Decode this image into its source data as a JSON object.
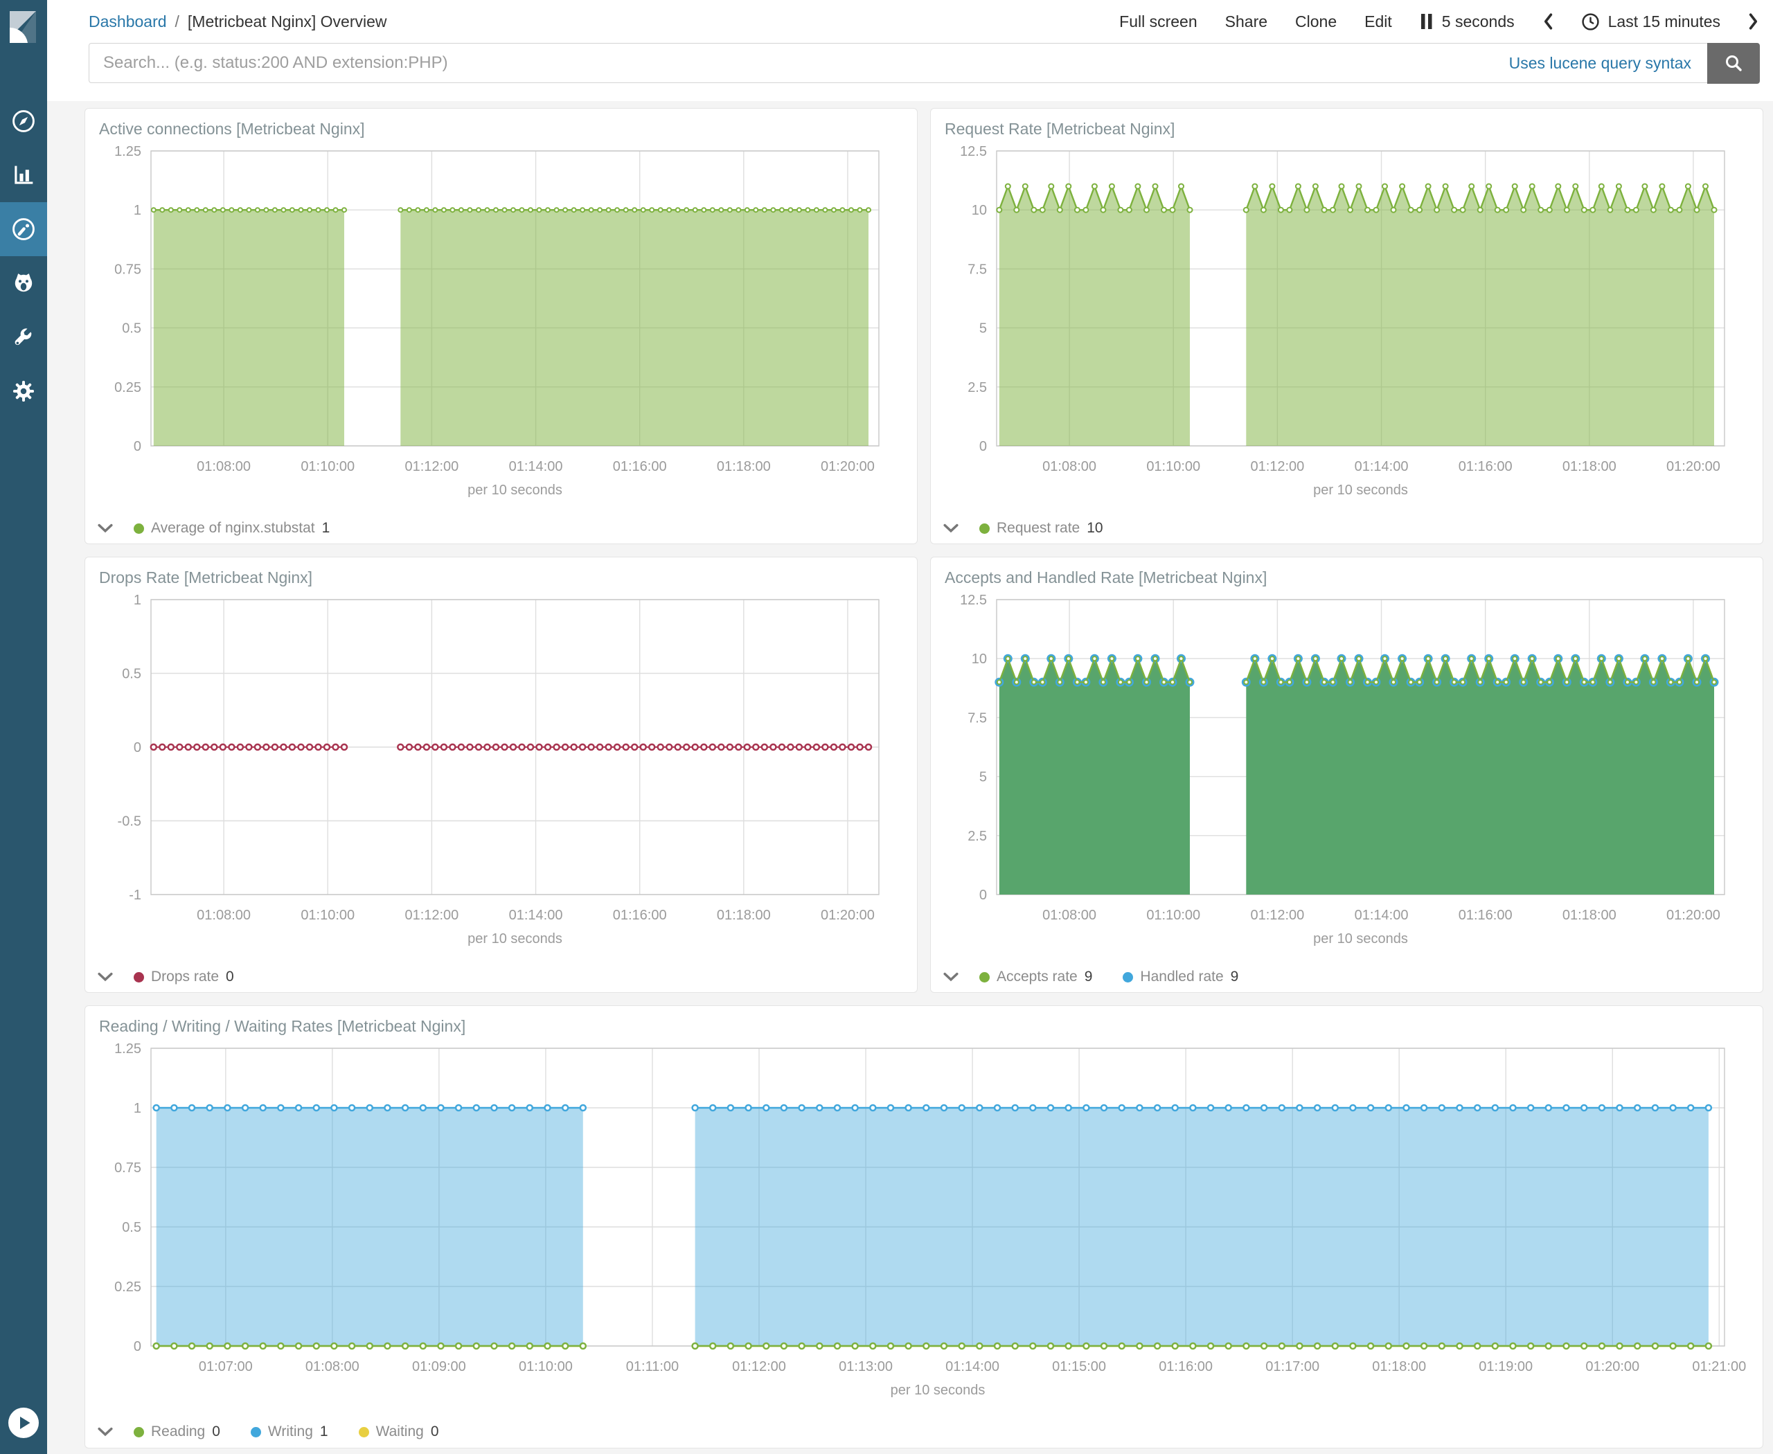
{
  "colors": {
    "sidebar_bg": "#2a566d",
    "sidebar_active_bg": "#3a7fa5",
    "link": "#2977a8",
    "page_bg": "#f4f4f4",
    "panel_title": "#849296",
    "tick": "#9b9b9b",
    "grid": "#dedede",
    "plot_border": "#c8c8c8",
    "green": "#7db13e",
    "green_fill": "rgba(125,177,62,0.5)",
    "blue": "#41a7dc",
    "blue_fill": "rgba(65,167,220,0.42)",
    "crimson": "#a8334f",
    "yellow": "#e8cf41",
    "accepts_fill": "#58a56c",
    "search_button_bg": "#6a6a6a"
  },
  "sidebar": {
    "items": [
      {
        "name": "discover",
        "icon": "compass-icon",
        "active": false
      },
      {
        "name": "visualize",
        "icon": "bar-chart-icon",
        "active": false
      },
      {
        "name": "dashboard",
        "icon": "gauge-icon",
        "active": true
      },
      {
        "name": "timelion",
        "icon": "timelion-icon",
        "active": false
      },
      {
        "name": "dev-tools",
        "icon": "wrench-icon",
        "active": false
      },
      {
        "name": "management",
        "icon": "gear-icon",
        "active": false
      }
    ]
  },
  "topnav": {
    "breadcrumb": {
      "link": "Dashboard",
      "separator": "/",
      "current": "[Metricbeat Nginx] Overview"
    },
    "menu": [
      "Full screen",
      "Share",
      "Clone",
      "Edit"
    ],
    "refresh_interval": "5 seconds",
    "time_range": "Last 15 minutes"
  },
  "search": {
    "placeholder": "Search... (e.g. status:200 AND extension:PHP)",
    "hint": "Uses lucene query syntax"
  },
  "panels": [
    {
      "title": "Active connections [Metricbeat Nginx]",
      "legend": [
        {
          "label": "Average of nginx.stubstat",
          "value": "1",
          "color_key": "green"
        }
      ],
      "chart_data": {
        "type": "area",
        "x_domain_min": [
          6.6,
          20.6
        ],
        "data_gap_min": [
          10.4,
          11.4
        ],
        "sample_interval_sec": 10,
        "xlabel": "per 10 seconds",
        "xticks": [
          [
            8,
            "01:08:00"
          ],
          [
            10,
            "01:10:00"
          ],
          [
            12,
            "01:12:00"
          ],
          [
            14,
            "01:14:00"
          ],
          [
            16,
            "01:16:00"
          ],
          [
            18,
            "01:18:00"
          ],
          [
            20,
            "01:20:00"
          ]
        ],
        "ylim": [
          0,
          1.25
        ],
        "yticks": [
          [
            0,
            "0"
          ],
          [
            0.25,
            "0.25"
          ],
          [
            0.5,
            "0.5"
          ],
          [
            0.75,
            "0.75"
          ],
          [
            1,
            "1"
          ],
          [
            1.25,
            "1.25"
          ]
        ],
        "series": [
          {
            "name": "Average of nginx.stubstat",
            "color_key": "green",
            "fill_key": "green_fill",
            "line": true,
            "base": 1,
            "spikes": null,
            "dots": {
              "r": 3,
              "sw": 2
            }
          }
        ]
      }
    },
    {
      "title": "Request Rate [Metricbeat Nginx]",
      "legend": [
        {
          "label": "Request rate",
          "value": "10",
          "color_key": "green"
        }
      ],
      "chart_data": {
        "type": "area",
        "x_domain_min": [
          6.6,
          20.6
        ],
        "data_gap_min": [
          10.4,
          11.4
        ],
        "sample_interval_sec": 10,
        "xlabel": "per 10 seconds",
        "xticks": [
          [
            8,
            "01:08:00"
          ],
          [
            10,
            "01:10:00"
          ],
          [
            12,
            "01:12:00"
          ],
          [
            14,
            "01:14:00"
          ],
          [
            16,
            "01:16:00"
          ],
          [
            18,
            "01:18:00"
          ],
          [
            20,
            "01:20:00"
          ]
        ],
        "ylim": [
          0,
          12.5
        ],
        "yticks": [
          [
            0,
            "0"
          ],
          [
            2.5,
            "2.5"
          ],
          [
            5,
            "5"
          ],
          [
            7.5,
            "7.5"
          ],
          [
            10,
            "10"
          ],
          [
            12.5,
            "12.5"
          ]
        ],
        "series": [
          {
            "name": "Request rate",
            "color_key": "green",
            "fill_key": "green_fill",
            "line": true,
            "base": 10,
            "spikes": {
              "mod": 5,
              "at": [
                1,
                3
              ],
              "value": 11
            },
            "dots": {
              "r": 3.5,
              "sw": 2
            }
          }
        ]
      }
    },
    {
      "title": "Drops Rate [Metricbeat Nginx]",
      "legend": [
        {
          "label": "Drops rate",
          "value": "0",
          "color_key": "crimson"
        }
      ],
      "chart_data": {
        "type": "line",
        "x_domain_min": [
          6.6,
          20.6
        ],
        "data_gap_min": [
          10.4,
          11.4
        ],
        "sample_interval_sec": 10,
        "xlabel": "per 10 seconds",
        "xticks": [
          [
            8,
            "01:08:00"
          ],
          [
            10,
            "01:10:00"
          ],
          [
            12,
            "01:12:00"
          ],
          [
            14,
            "01:14:00"
          ],
          [
            16,
            "01:16:00"
          ],
          [
            18,
            "01:18:00"
          ],
          [
            20,
            "01:20:00"
          ]
        ],
        "ylim": [
          -1,
          1
        ],
        "yticks": [
          [
            -1,
            "-1"
          ],
          [
            -0.5,
            "-0.5"
          ],
          [
            0,
            "0"
          ],
          [
            0.5,
            "0.5"
          ],
          [
            1,
            "1"
          ]
        ],
        "series": [
          {
            "name": "Drops rate",
            "color_key": "crimson",
            "fill_key": null,
            "line": true,
            "lw": 2,
            "base": 0,
            "spikes": null,
            "dots": {
              "r": 4,
              "sw": 2.5
            }
          }
        ]
      }
    },
    {
      "title": "Accepts and Handled Rate [Metricbeat Nginx]",
      "legend": [
        {
          "label": "Accepts rate",
          "value": "9",
          "color_key": "green"
        },
        {
          "label": "Handled rate",
          "value": "9",
          "color_key": "blue"
        }
      ],
      "chart_data": {
        "type": "area",
        "x_domain_min": [
          6.6,
          20.6
        ],
        "data_gap_min": [
          10.4,
          11.4
        ],
        "sample_interval_sec": 10,
        "xlabel": "per 10 seconds",
        "xticks": [
          [
            8,
            "01:08:00"
          ],
          [
            10,
            "01:10:00"
          ],
          [
            12,
            "01:12:00"
          ],
          [
            14,
            "01:14:00"
          ],
          [
            16,
            "01:16:00"
          ],
          [
            18,
            "01:18:00"
          ],
          [
            20,
            "01:20:00"
          ]
        ],
        "ylim": [
          0,
          12.5
        ],
        "yticks": [
          [
            0,
            "0"
          ],
          [
            2.5,
            "2.5"
          ],
          [
            5,
            "5"
          ],
          [
            7.5,
            "7.5"
          ],
          [
            10,
            "10"
          ],
          [
            12.5,
            "12.5"
          ]
        ],
        "series": [
          {
            "name": "Handled rate",
            "color_key": "blue",
            "fill_key": "accepts_fill",
            "line": false,
            "base": 9,
            "spikes": {
              "mod": 5,
              "at": [
                1,
                3
              ],
              "value": 10
            },
            "dots": {
              "r": 5,
              "sw": 3
            }
          },
          {
            "name": "Accepts rate",
            "color_key": "green",
            "fill_key": null,
            "line": true,
            "base": 9,
            "spikes": {
              "mod": 5,
              "at": [
                1,
                3
              ],
              "value": 10
            },
            "dots": {
              "r": 3,
              "sw": 2
            }
          }
        ]
      }
    },
    {
      "title": "Reading / Writing / Waiting Rates [Metricbeat Nginx]",
      "legend": [
        {
          "label": "Reading",
          "value": "0",
          "color_key": "green"
        },
        {
          "label": "Writing",
          "value": "1",
          "color_key": "blue"
        },
        {
          "label": "Waiting",
          "value": "0",
          "color_key": "yellow"
        }
      ],
      "chart_data": {
        "type": "area",
        "x_domain_min": [
          6.3,
          21.05
        ],
        "data_gap_min": [
          10.4,
          11.4
        ],
        "sample_interval_sec": 10,
        "xlabel": "per 10 seconds",
        "xticks": [
          [
            7,
            "01:07:00"
          ],
          [
            8,
            "01:08:00"
          ],
          [
            9,
            "01:09:00"
          ],
          [
            10,
            "01:10:00"
          ],
          [
            11,
            "01:11:00"
          ],
          [
            12,
            "01:12:00"
          ],
          [
            13,
            "01:13:00"
          ],
          [
            14,
            "01:14:00"
          ],
          [
            15,
            "01:15:00"
          ],
          [
            16,
            "01:16:00"
          ],
          [
            17,
            "01:17:00"
          ],
          [
            18,
            "01:18:00"
          ],
          [
            19,
            "01:19:00"
          ],
          [
            20,
            "01:20:00"
          ],
          [
            21,
            "01:21:00"
          ]
        ],
        "ylim": [
          0,
          1.25
        ],
        "yticks": [
          [
            0,
            "0"
          ],
          [
            0.25,
            "0.25"
          ],
          [
            0.5,
            "0.5"
          ],
          [
            0.75,
            "0.75"
          ],
          [
            1,
            "1"
          ],
          [
            1.25,
            "1.25"
          ]
        ],
        "series": [
          {
            "name": "Waiting",
            "color_key": "yellow",
            "fill_key": null,
            "line": true,
            "base": 0,
            "spikes": null,
            "dots": {
              "r": 3,
              "sw": 2
            }
          },
          {
            "name": "Writing",
            "color_key": "blue",
            "fill_key": "blue_fill",
            "line": true,
            "base": 1,
            "spikes": null,
            "dots": {
              "r": 4,
              "sw": 2.5
            }
          },
          {
            "name": "Reading",
            "color_key": "green",
            "fill_key": null,
            "line": true,
            "base": 0,
            "spikes": null,
            "dots": {
              "r": 4,
              "sw": 2.5
            }
          }
        ]
      }
    }
  ]
}
